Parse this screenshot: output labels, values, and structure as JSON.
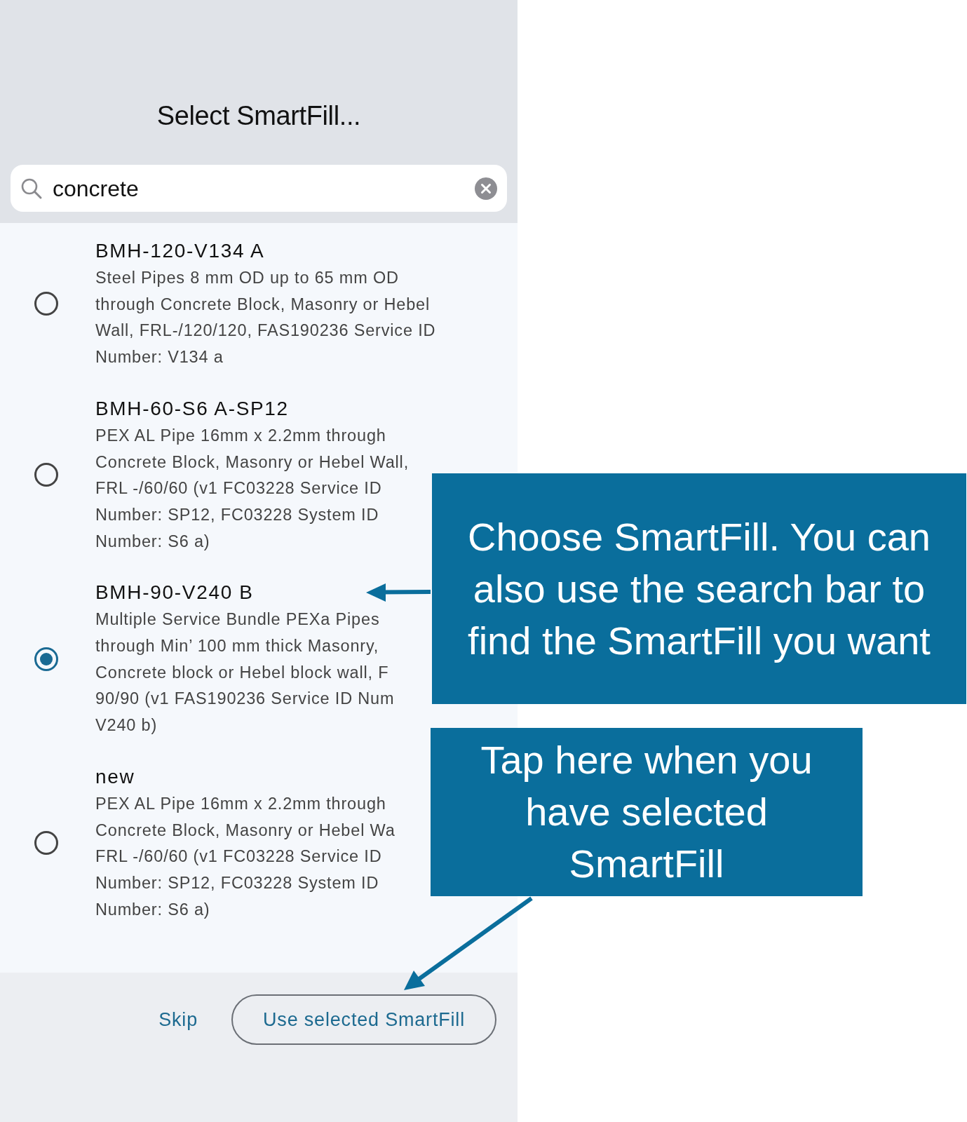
{
  "header": {
    "title": "Select SmartFill..."
  },
  "search": {
    "value": "concrete"
  },
  "items": [
    {
      "code": "BMH-120-V134 A",
      "description_lines": [
        "Steel Pipes 8 mm OD up to 65 mm OD",
        "through Concrete Block, Masonry or Hebel",
        "Wall, FRL-/120/120, FAS190236 Service ID",
        "Number: V134 a"
      ],
      "selected": false
    },
    {
      "code": "BMH-60-S6 A-SP12",
      "description_lines": [
        "PEX AL Pipe 16mm x 2.2mm through",
        "Concrete Block, Masonry or Hebel Wall,",
        "FRL -/60/60 (v1 FC03228 Service ID",
        "Number: SP12, FC03228 System ID",
        "Number: S6 a)"
      ],
      "selected": false
    },
    {
      "code": "BMH-90-V240 B",
      "description_lines": [
        "Multiple Service Bundle PEXa Pipes",
        "through Min’ 100 mm thick Masonry,",
        "Concrete block or Hebel block wall, F",
        "90/90 (v1 FAS190236 Service ID Num",
        "V240 b)"
      ],
      "selected": true
    },
    {
      "code": "new",
      "description_lines": [
        "PEX AL Pipe 16mm x 2.2mm through",
        "Concrete Block, Masonry or Hebel Wa",
        "FRL -/60/60 (v1 FC03228 Service ID",
        "Number: SP12, FC03228 System ID",
        "Number: S6 a)"
      ],
      "selected": false
    }
  ],
  "footer": {
    "buttons": [
      {
        "label": "Skip",
        "kind": "text"
      },
      {
        "label": "Use selected SmartFill",
        "kind": "outlined"
      }
    ]
  },
  "annotations": [
    {
      "text": "Choose SmartFill. You can also use the search bar to find the SmartFill you want"
    },
    {
      "text": "Tap here when you have selected SmartFill"
    }
  ]
}
